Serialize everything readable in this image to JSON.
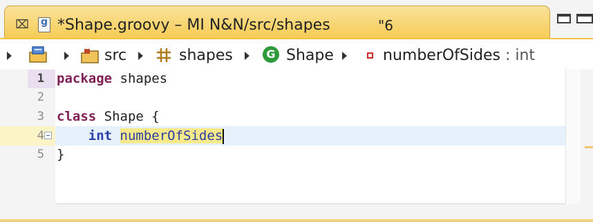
{
  "tab": {
    "close_glyph": "⌧",
    "title": "*Shape.groovy – MI N&N/src/shapes",
    "overflow": "\"6",
    "icon": "groovy-file-icon"
  },
  "view_controls": {
    "minimize_icon": "minimize-icon",
    "maximize_icon": "maximize-icon"
  },
  "breadcrumb": {
    "items": [
      {
        "icon": "project-icon",
        "label": ""
      },
      {
        "icon": "source-folder-icon",
        "label": "src"
      },
      {
        "icon": "package-icon",
        "label": "shapes"
      },
      {
        "icon": "class-icon",
        "label": "Shape",
        "icon_glyph": "G"
      },
      {
        "icon": "field-icon",
        "label": "numberOfSides",
        "type": " : int"
      }
    ]
  },
  "editor": {
    "lines": [
      {
        "number": "1",
        "tokens": {
          "keyword": "package",
          "rest": " shapes"
        }
      },
      {
        "number": "2",
        "tokens": {}
      },
      {
        "number": "3",
        "tokens": {
          "keyword": "class",
          "rest": " Shape {"
        }
      },
      {
        "number": "4",
        "tokens": {
          "indent": "    ",
          "type": "int",
          "space": " ",
          "field": "numberOfSides"
        }
      },
      {
        "number": "5",
        "tokens": {
          "rest": "}"
        }
      }
    ],
    "current_line": 4
  },
  "colors": {
    "active_tab": "#f6cc55",
    "keyword": "#7f1f55",
    "type_keyword": "#2a3fa8",
    "occurrence_highlight": "#f6e98c",
    "current_line": "#e7f1fc",
    "class_icon": "#2e9a3a",
    "field_icon": "#d02a2a"
  }
}
